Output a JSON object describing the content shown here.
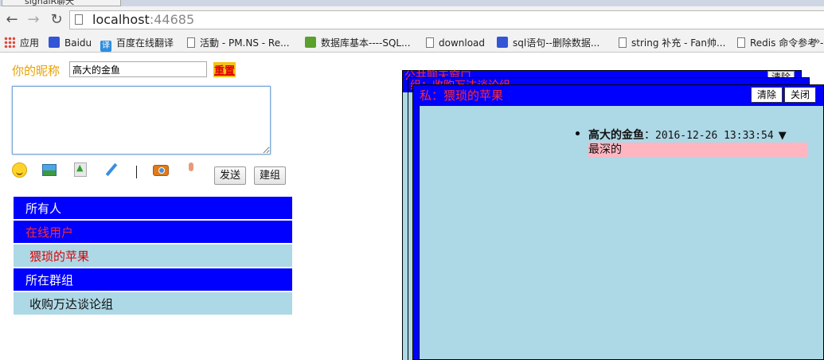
{
  "browser": {
    "tab_title": "signalR聊天",
    "url_host": "localhost",
    "url_port": ":44685",
    "bookmarks": [
      {
        "label": "应用",
        "icon": "apps-icon"
      },
      {
        "label": "Baidu",
        "icon": "baidu-paw-icon"
      },
      {
        "label": "百度在线翻译",
        "icon": "translate-icon"
      },
      {
        "label": "活動 - PM.NS - Re...",
        "icon": "page-icon"
      },
      {
        "label": "数据库基本----SQL...",
        "icon": "green-site-icon"
      },
      {
        "label": "download",
        "icon": "page-icon"
      },
      {
        "label": "sql语句--删除数据...",
        "icon": "baidu-paw-icon"
      },
      {
        "label": "string 补充 - Fan帅...",
        "icon": "page-icon"
      },
      {
        "label": "Redis 命令参考 -",
        "icon": "page-icon"
      }
    ],
    "bookmarks_more": "»"
  },
  "form": {
    "nick_label": "你的昵称",
    "nick_value": "高大的金鱼",
    "reset_label": "重置",
    "send_label": "发送",
    "group_label": "建组"
  },
  "sidebar": {
    "all_header": "所有人",
    "online_header": "在线用户",
    "online_users": [
      "猥琐的苹果"
    ],
    "groups_header": "所在群组",
    "groups": [
      "收购万达谈论组"
    ]
  },
  "chat": {
    "public_title": "公共聊天窗口",
    "public_clear": "清除",
    "group_title": "组：收购万达谈论组",
    "private_title": "私：猥琐的苹果",
    "clear_label": "清除",
    "close_label": "关闭",
    "message": {
      "user": "高大的金鱼",
      "separator": "：",
      "time": "2016-12-26 13:33:54",
      "arrow": "▼",
      "text": "最深的"
    }
  },
  "colors": {
    "header_blue": "#0000ff",
    "light_blue": "#add8e6",
    "accent_red": "#ff2a2a",
    "nick_orange": "#e8a000",
    "message_pink": "#ffb6c1"
  }
}
